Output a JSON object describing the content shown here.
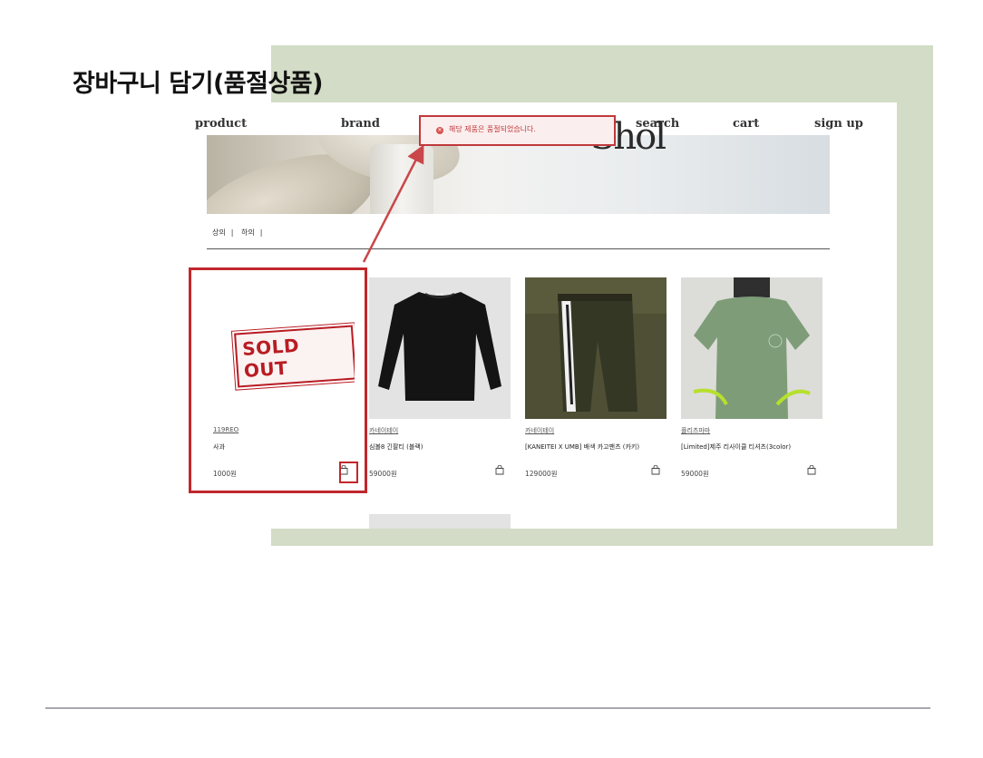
{
  "slide": {
    "title": "장바구니 담기(품절상품)"
  },
  "nav": {
    "product": "product",
    "brand": "brand",
    "search": "search",
    "cart": "cart",
    "signup": "sign up"
  },
  "logo_fragment": "Shol",
  "toast": {
    "message": "해당 제품은 품절되었습니다."
  },
  "categories": [
    "상의",
    "하의"
  ],
  "products": [
    {
      "brand": "119REO",
      "name": "사과",
      "price": "1000원",
      "badge": "SOLD OUT"
    },
    {
      "brand": "카네이테이",
      "name": "심볼8 긴팔티 (블랙)",
      "price": "59000원"
    },
    {
      "brand": "카네이테이",
      "name": "[KANEITEI X UMB] 배색 카고팬츠 (카키)",
      "price": "129000원"
    },
    {
      "brand": "플리츠마마",
      "name": "[Limited]제주 리사이클 티셔츠(3color)",
      "price": "59000원"
    }
  ],
  "colors": {
    "highlight": "#c1272d",
    "frame": "#d3dcc6",
    "toast_bg": "#fbeeee"
  }
}
